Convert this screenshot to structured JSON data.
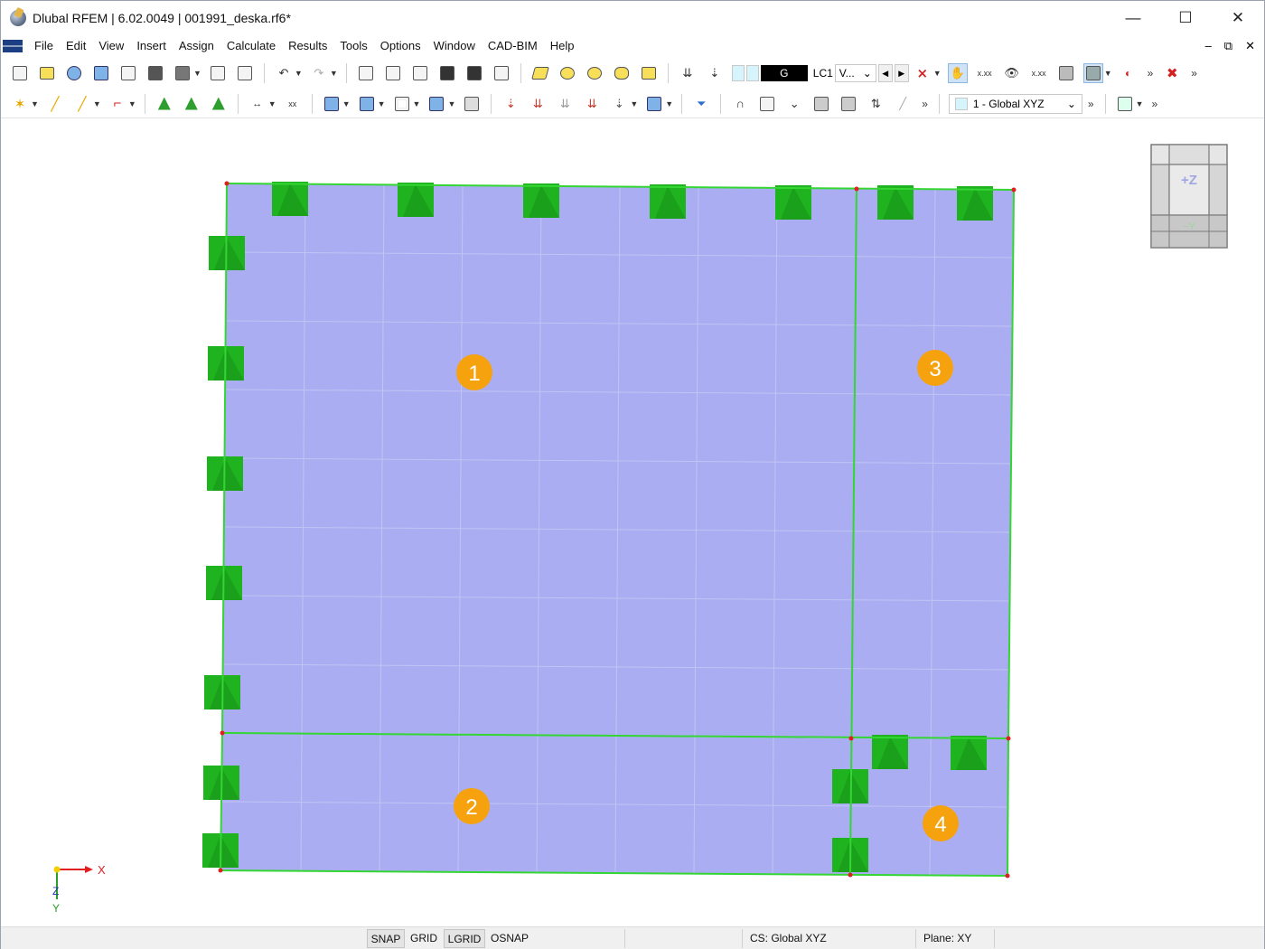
{
  "window": {
    "title": "Dlubal RFEM | 6.02.0049 | 001991_deska.rf6*",
    "minimize_glyph": "—",
    "maximize_glyph": "☐",
    "close_glyph": "✕"
  },
  "menu": {
    "items": [
      "File",
      "Edit",
      "View",
      "Insert",
      "Assign",
      "Calculate",
      "Results",
      "Tools",
      "Options",
      "Window",
      "CAD-BIM",
      "Help"
    ],
    "right_controls": [
      "–",
      "⧉",
      "✕"
    ]
  },
  "toolbar1": {
    "load_case_type": "G",
    "load_case_name": "LC1",
    "view_select": "V...",
    "more": "»"
  },
  "toolbar2": {
    "coordinate_system": "1 - Global XYZ",
    "more": "»"
  },
  "viewport": {
    "surface_labels": [
      "1",
      "2",
      "3",
      "4"
    ],
    "colors": {
      "surface_fill": "#aaadf2",
      "line": "#33d633",
      "node": "#e02020",
      "support": "#1fb31f",
      "label_badge": "#f5a20e"
    },
    "view_cube": {
      "top_label": "+Z",
      "bottom_label": "−Y"
    },
    "axes": {
      "x_label": "X",
      "y_label": "Y",
      "z_label": "Z"
    }
  },
  "statusbar": {
    "toggles": [
      "SNAP",
      "GRID",
      "LGRID",
      "OSNAP"
    ],
    "coordinate_system": "CS: Global XYZ",
    "plane": "Plane: XY"
  }
}
